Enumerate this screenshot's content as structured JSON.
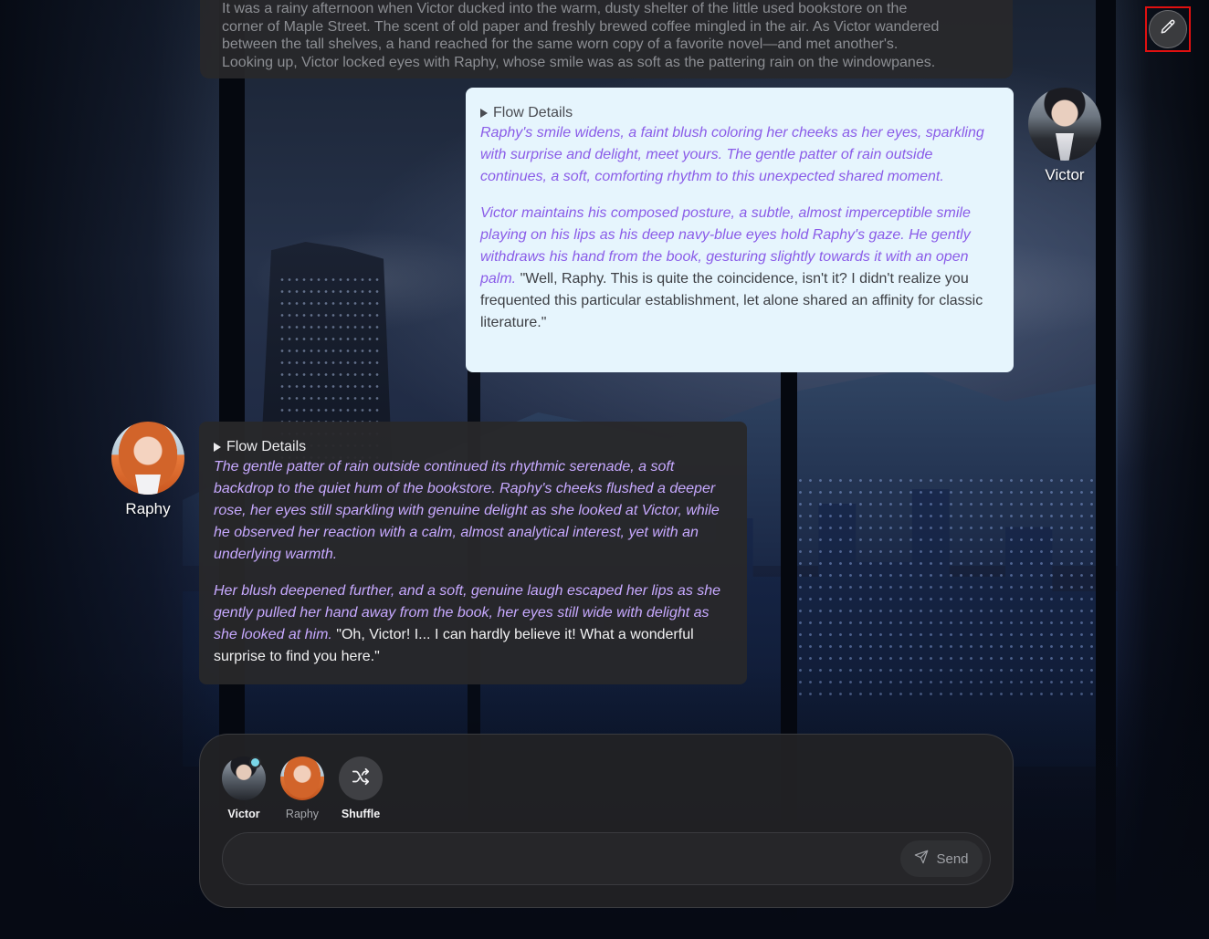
{
  "story": {
    "top_excerpt": [
      "It was a rainy afternoon when Victor ducked into the warm, dusty shelter of the little used bookstore on the",
      "corner of Maple Street. The scent of old paper and freshly brewed coffee mingled in the air. As Victor wandered",
      "between the tall shelves, a hand reached for the same worn copy of a favorite novel—and met another's.",
      "Looking up, Victor locked eyes with Raphy, whose smile was as soft as the pattering rain on the windowpanes."
    ]
  },
  "toolbar": {
    "edit_icon": "pencil-icon"
  },
  "messages": [
    {
      "speaker": "Victor",
      "flow_label": "Flow Details",
      "paragraph1_action": "Raphy's smile widens, a faint blush coloring her cheeks as her eyes, sparkling with surprise and delight, meet yours. The gentle patter of rain outside continues, a soft, comforting rhythm to this unexpected shared moment.",
      "paragraph2_action": "Victor maintains his composed posture, a subtle, almost imperceptible smile playing on his lips as his deep navy-blue eyes hold Raphy's gaze. He gently withdraws his hand from the book, gesturing slightly towards it with an open palm.",
      "paragraph2_speech": " \"Well, Raphy. This is quite the coincidence, isn't it? I didn't realize you frequented this particular establishment, let alone shared an affinity for classic literature.\""
    },
    {
      "speaker": "Raphy",
      "flow_label": "Flow Details",
      "paragraph1_action": "The gentle patter of rain outside continued its rhythmic serenade, a soft backdrop to the quiet hum of the bookstore. Raphy's cheeks flushed a deeper rose, her eyes still sparkling with genuine delight as she looked at Victor, while he observed her reaction with a calm, almost analytical interest, yet with an underlying warmth.",
      "paragraph2_action": "Her blush deepened further, and a soft, genuine laugh escaped her lips as she gently pulled her hand away from the book, her eyes still wide with delight as she looked at him.",
      "paragraph2_speech": " \"Oh, Victor! I... I can hardly believe it! What a wonderful surprise to find you here.\""
    }
  ],
  "composer": {
    "characters": [
      {
        "label": "Victor",
        "selected": true,
        "online": true
      },
      {
        "label": "Raphy",
        "selected": false
      },
      {
        "label": "Shuffle",
        "icon": "shuffle-icon"
      }
    ],
    "input_value": "",
    "input_placeholder": "",
    "send_label": "Send",
    "send_icon": "paper-plane-icon"
  },
  "colors": {
    "user_bubble": "#e6f5fd",
    "character_bubble": "#28282a",
    "action_text_light": "#8a5ce8",
    "action_text_dark": "#c7a9ff",
    "highlight_frame": "#e01010"
  }
}
